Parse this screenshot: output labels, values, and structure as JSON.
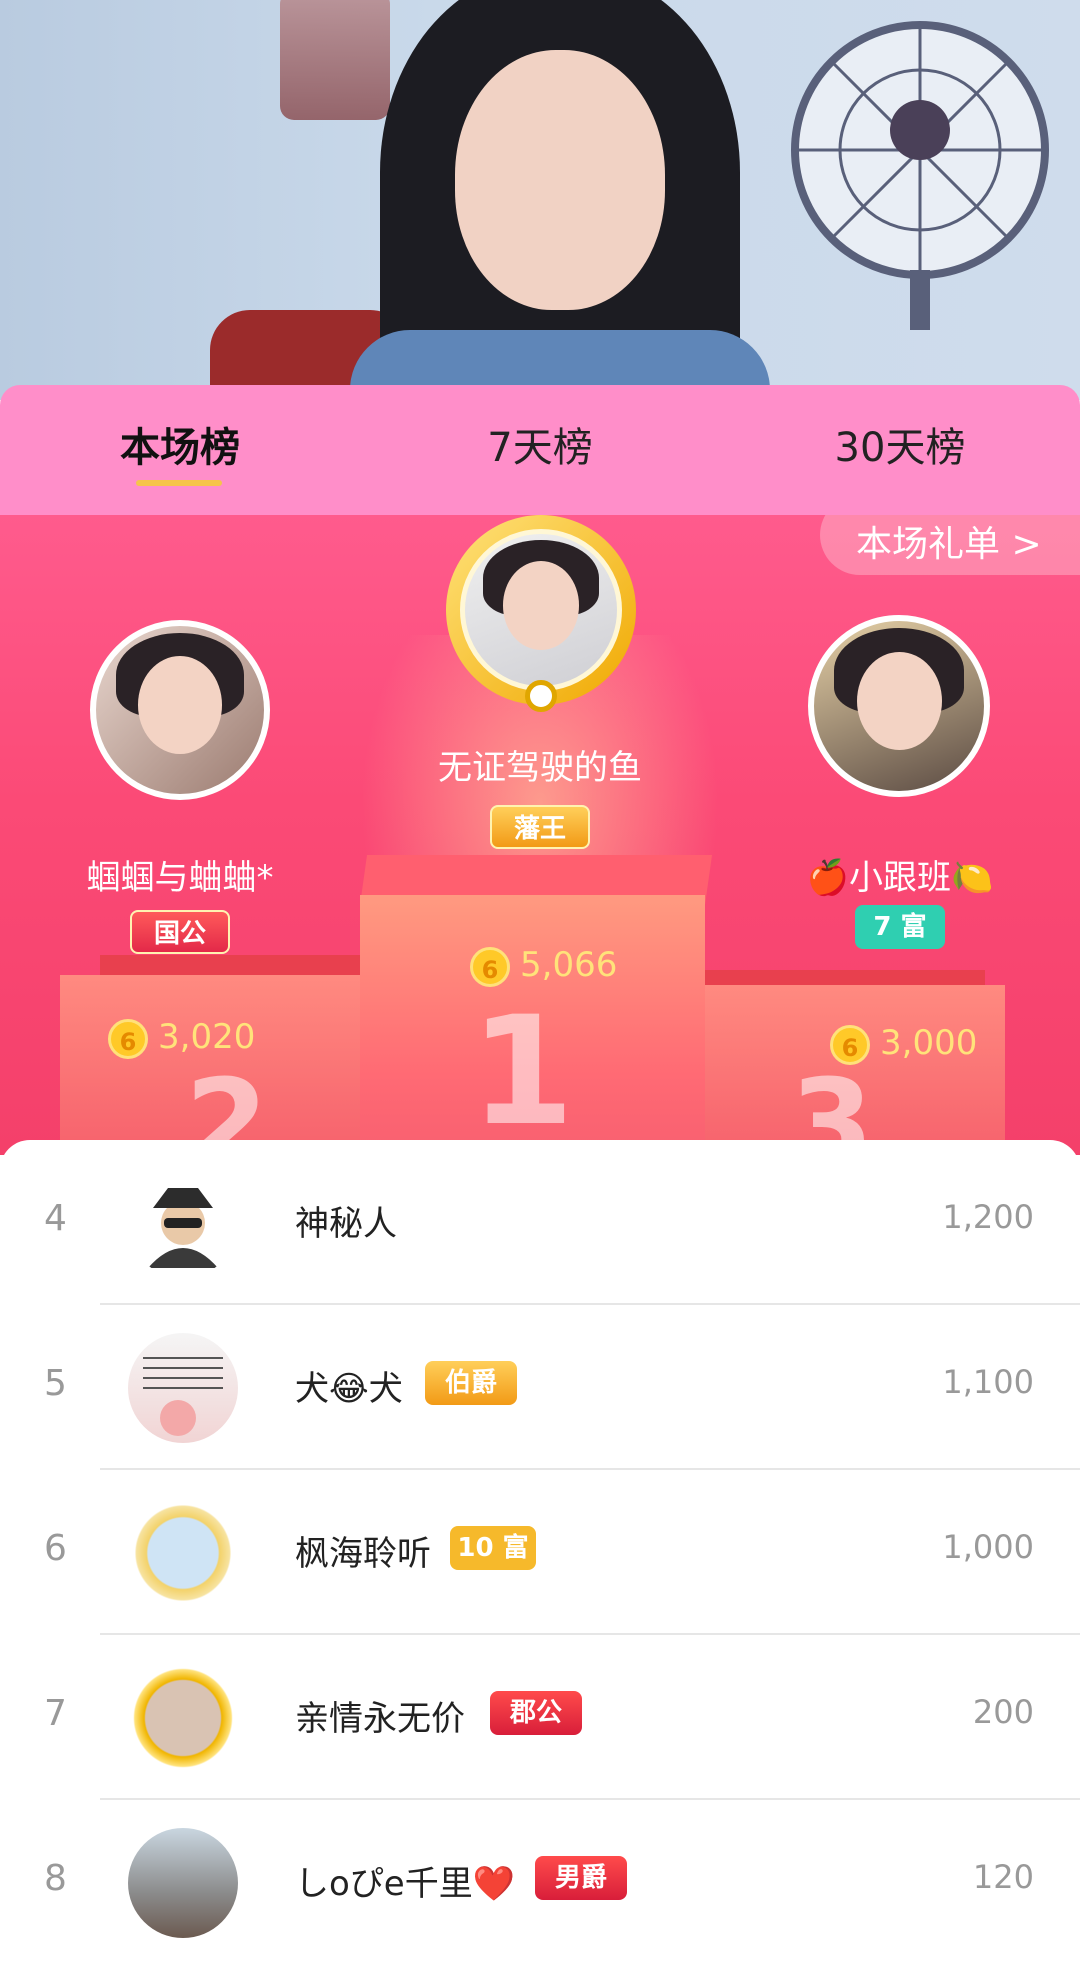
{
  "tabs": [
    {
      "label": "本场榜"
    },
    {
      "label": "7天榜"
    },
    {
      "label": "30天榜"
    }
  ],
  "gift_list_link": "本场礼单 >",
  "podium": {
    "first": {
      "name": "无证驾驶的鱼",
      "badge": "藩王",
      "score": "5,066",
      "place": "1"
    },
    "second": {
      "name": "蝈蝈与蛐蛐*",
      "badge": "国公",
      "score": "3,020",
      "place": "2"
    },
    "third": {
      "name": "🍎小跟班🍋",
      "badge": "7 富",
      "score": "3,000",
      "place": "3"
    }
  },
  "coin_symbol": "6",
  "ranking": [
    {
      "rank": "4",
      "name": "神秘人",
      "badge": "",
      "score": "1,200"
    },
    {
      "rank": "5",
      "name": "犬😂犬",
      "badge": "伯爵",
      "score": "1,100"
    },
    {
      "rank": "6",
      "name": "枫海聆听",
      "badge": "10 富",
      "score": "1,000"
    },
    {
      "rank": "7",
      "name": "亲情永无价",
      "badge": "郡公",
      "score": "200"
    },
    {
      "rank": "8",
      "name": "しoぴe千里❤️",
      "badge": "男爵",
      "score": "120"
    }
  ],
  "colors": {
    "tab_bg": "#ff8ec9",
    "podium_bg": "#fb4a76",
    "score_gold": "#ffe37a",
    "teal_badge": "#2fcfb1",
    "gold_badge": "#f29a16",
    "red_badge": "#d81e3a"
  }
}
